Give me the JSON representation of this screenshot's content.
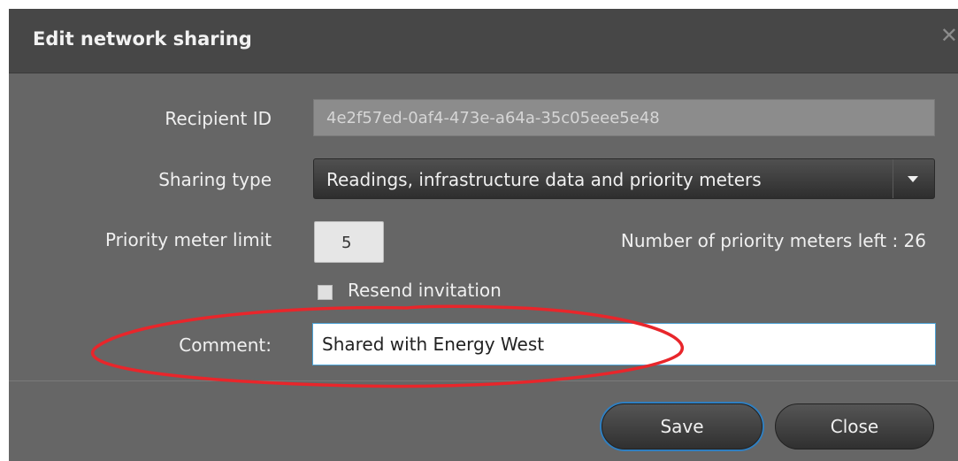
{
  "dialog": {
    "title": "Edit network sharing",
    "close_icon": "close-icon"
  },
  "form": {
    "recipient_label": "Recipient ID",
    "recipient_value": "4e2f57ed-0af4-473e-a64a-35c05eee5e48",
    "sharing_type_label": "Sharing type",
    "sharing_type_value": "Readings, infrastructure data and priority meters",
    "priority_limit_label": "Priority meter limit",
    "priority_limit_value": "5",
    "meters_left_text": "Number of priority meters left : 26",
    "resend_label": "Resend invitation",
    "resend_checked": false,
    "comment_label": "Comment:",
    "comment_value": "Shared with Energy West"
  },
  "buttons": {
    "save": "Save",
    "close": "Close"
  },
  "colors": {
    "dialog_bg": "#666666",
    "titlebar_bg": "#474747",
    "focus_blue": "#2f7fc1",
    "annotation_red": "#e8262b"
  }
}
